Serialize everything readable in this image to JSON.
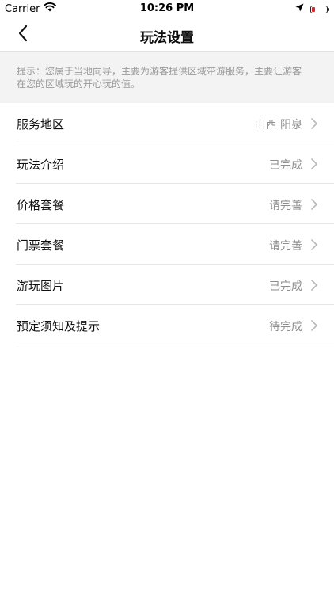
{
  "status_bar": {
    "carrier": "Carrier",
    "time": "10:26 PM",
    "battery_color": "#e0262c"
  },
  "nav": {
    "title": "玩法设置",
    "back_icon": "chevron-left-icon"
  },
  "tip": {
    "line1": "提示：您属于当地向导，主要为游客提供区域带游服务，主要让游客",
    "line2": "在您的区域玩的开心玩的值。"
  },
  "menu": {
    "items": [
      {
        "label": "服务地区",
        "value": "山西 阳泉"
      },
      {
        "label": "玩法介绍",
        "value": "已完成"
      },
      {
        "label": "价格套餐",
        "value": "请完善"
      },
      {
        "label": "门票套餐",
        "value": "请完善"
      },
      {
        "label": "游玩图片",
        "value": "已完成"
      },
      {
        "label": "预定须知及提示",
        "value": "待完成"
      }
    ]
  }
}
